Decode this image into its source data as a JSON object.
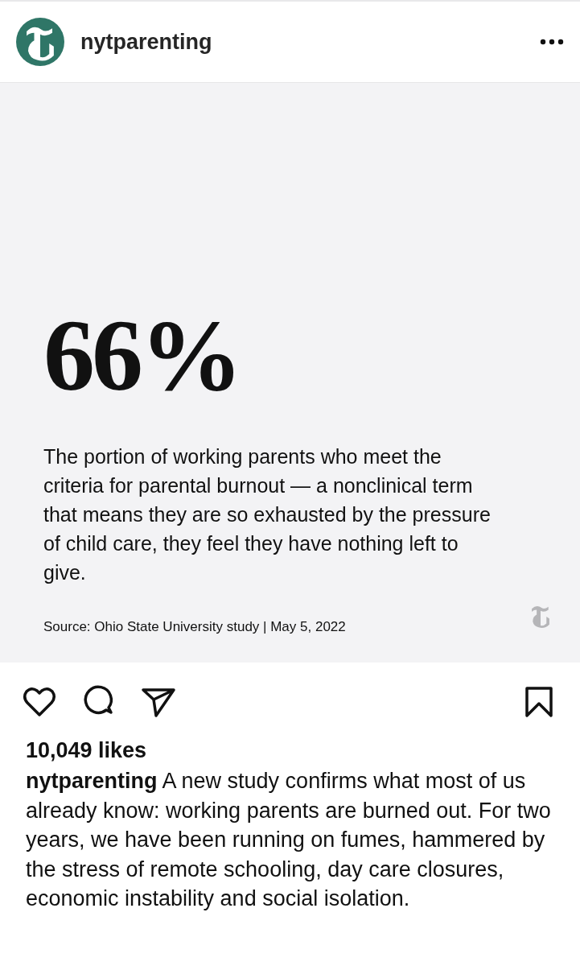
{
  "header": {
    "username": "nytparenting"
  },
  "post": {
    "stat": "66%",
    "description": "The portion of working parents who meet the criteria for parental burnout — a nonclinical term that means they are so exhausted by the pressure of child care, they feel they have nothing left to give.",
    "source": "Source: Ohio State University study | May 5, 2022"
  },
  "actions": {
    "liked": false,
    "saved": false
  },
  "likes": "10,049 likes",
  "caption": "**nytparenting** A new study confirms what most of us already know: working parents are burned out. For two years, we have been running on fumes, hammered by the stress of remote schooling, day care closures, economic instability and social isolation."
}
